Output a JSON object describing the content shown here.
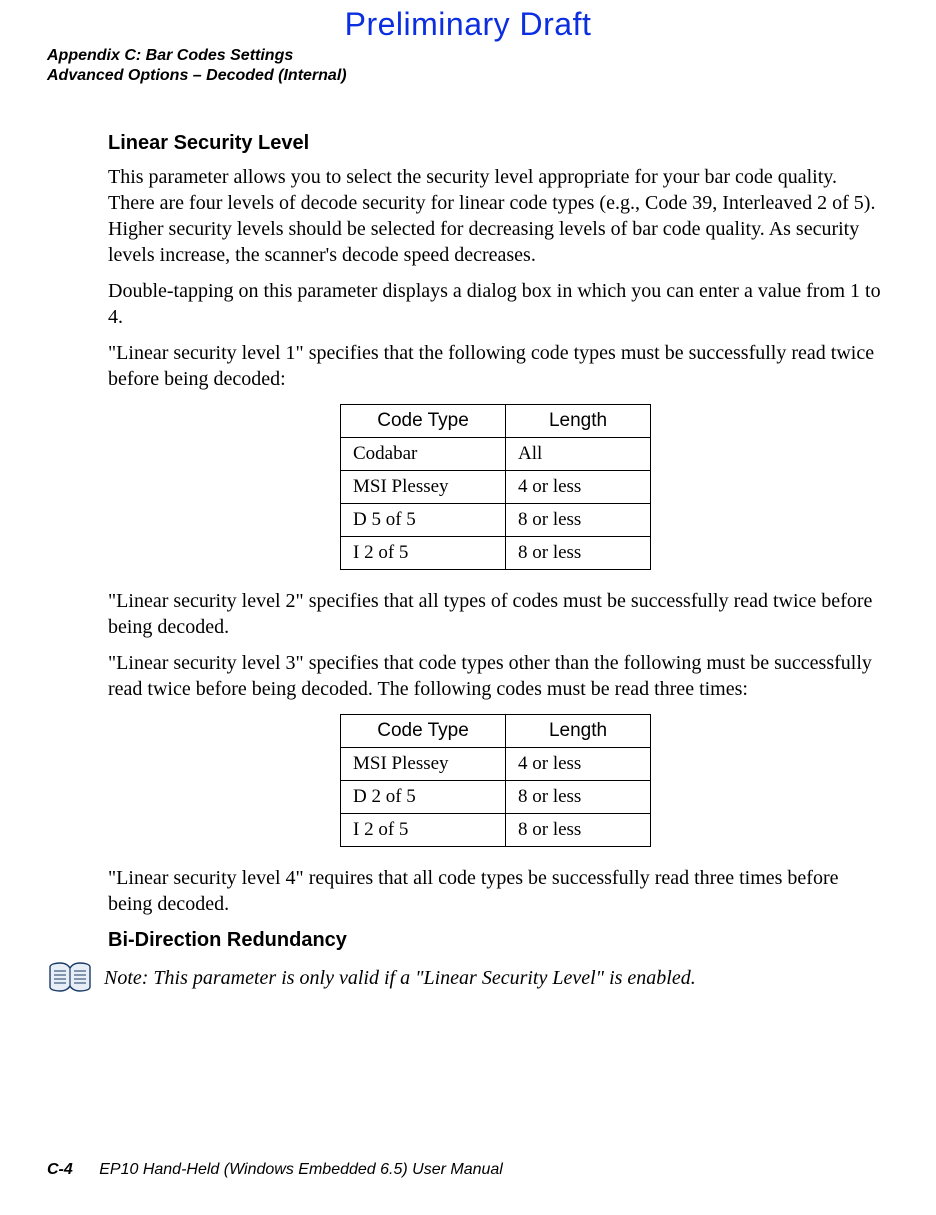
{
  "watermark": "Preliminary Draft",
  "header": {
    "line1": "Appendix C: Bar Codes Settings",
    "line2": "Advanced Options – Decoded (Internal)"
  },
  "section1": {
    "title": "Linear Security Level",
    "p1": "This parameter allows you to select the security level appropriate for your bar code quality. There are four levels of decode security for linear code types (e.g., Code 39, Interleaved 2 of 5). Higher security levels should be selected for decreasing levels of bar code quality. As security levels increase, the scanner's decode speed decreases.",
    "p2": "Double-tapping on this parameter displays a dialog box in which you can enter a value from 1 to 4.",
    "p3": "\"Linear security level 1\" specifies that the following code types must be successfully read twice before being decoded:",
    "table1": {
      "headers": [
        "Code Type",
        "Length"
      ],
      "rows": [
        [
          "Codabar",
          "All"
        ],
        [
          "MSI Plessey",
          "4 or less"
        ],
        [
          "D 5 of 5",
          "8 or less"
        ],
        [
          "I 2 of 5",
          "8 or less"
        ]
      ]
    },
    "p4": "\"Linear security level 2\" specifies that all types of codes must be successfully read twice before being decoded.",
    "p5": "\"Linear security level 3\" specifies that code types other than the following must be successfully read twice before being decoded. The following codes must be read three times:",
    "table2": {
      "headers": [
        "Code Type",
        "Length"
      ],
      "rows": [
        [
          "MSI Plessey",
          "4 or less"
        ],
        [
          "D 2 of 5",
          "8 or less"
        ],
        [
          "I 2 of 5",
          "8 or less"
        ]
      ]
    },
    "p6": "\"Linear security level 4\" requires that all code types be successfully read three times before being decoded."
  },
  "section2": {
    "title": "Bi-Direction Redundancy",
    "note": "Note: This parameter is only valid if a \"Linear Security Level\" is enabled."
  },
  "footer": {
    "pagenum": "C-4",
    "booktitle": "EP10 Hand-Held (Windows Embedded 6.5) User Manual"
  }
}
